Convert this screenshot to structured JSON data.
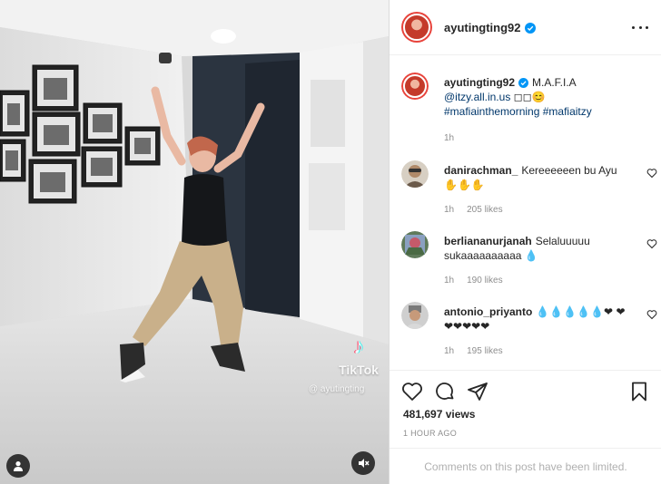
{
  "header": {
    "username": "ayutingting92"
  },
  "caption": {
    "username": "ayutingting92",
    "line1": "M.A.F.I.A",
    "mention": "@itzy.all.in.us",
    "mention_suffix": " ◻◻😊",
    "hashtags": "#mafiainthemorning #mafiaitzy",
    "time": "1h"
  },
  "comments": [
    {
      "username": "danirachman_",
      "text": "Kereeeeeen bu Ayu ✋✋✋",
      "time": "1h",
      "likes": "205 likes"
    },
    {
      "username": "berliananurjanah",
      "text": "Selaluuuuu sukaaaaaaaaaa 💧",
      "time": "1h",
      "likes": "190 likes"
    },
    {
      "username": "antonio_priyanto",
      "text": "💧💧💧💧💧❤ ❤❤❤❤❤❤",
      "time": "1h",
      "likes": "195 likes"
    }
  ],
  "stats": {
    "views": "481,697 views",
    "posted": "1 HOUR AGO"
  },
  "footer": {
    "limited_text": "Comments on this post have been limited."
  },
  "media": {
    "watermark": "TikTok",
    "watermark_handle": "@ ayutingting"
  },
  "colors": {
    "verified": "#0095f6",
    "link": "#00376b",
    "muted": "#8e8e8e",
    "avatar_ring": "#e8433b"
  }
}
